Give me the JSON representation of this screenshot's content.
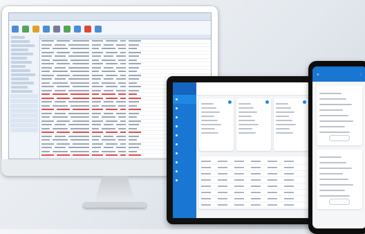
{
  "desktop": {
    "ribbon_buttons": [
      {
        "color": "#4b8cd8"
      },
      {
        "color": "#56a35b"
      },
      {
        "color": "#e0a030"
      },
      {
        "color": "#4b8cd8"
      },
      {
        "color": "#7a7a9a"
      },
      {
        "color": "#56a35b"
      },
      {
        "color": "#4b8cd8"
      },
      {
        "color": "#d94a3a"
      },
      {
        "color": "#4b8cd8"
      }
    ]
  },
  "tablet": {
    "nav_color": "#1976d2"
  },
  "phone": {
    "header_color": "#1976d2"
  }
}
